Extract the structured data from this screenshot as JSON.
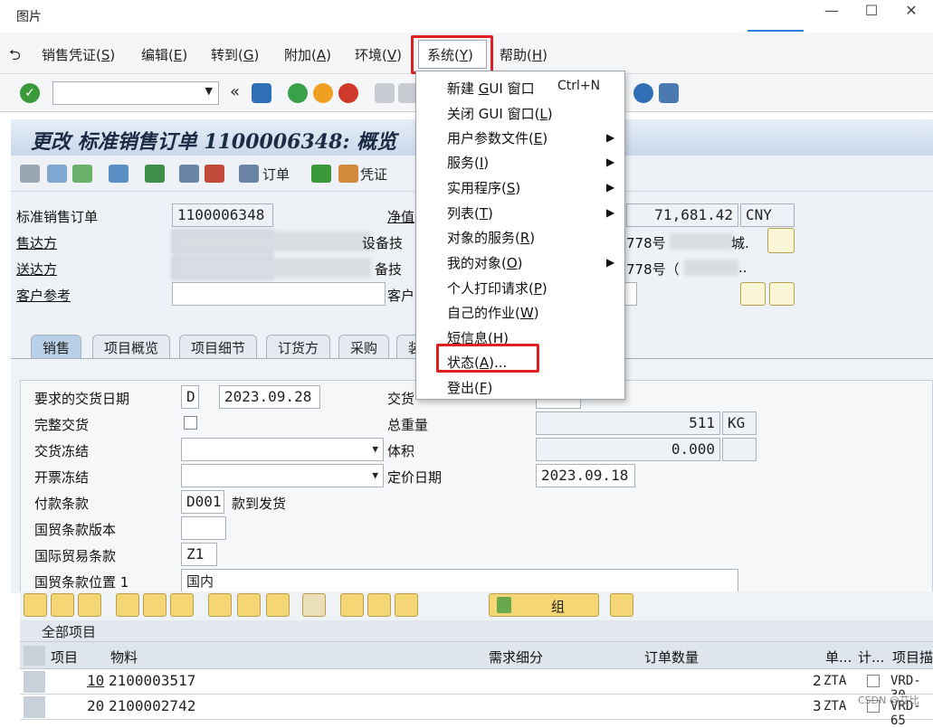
{
  "window": {
    "title": "图片",
    "controls": [
      "—",
      "☐",
      "✕"
    ]
  },
  "menubar": {
    "items": [
      {
        "label": "销售凭证(",
        "key": "S",
        "tail": ")"
      },
      {
        "label": "编辑(",
        "key": "E",
        "tail": ")"
      },
      {
        "label": "转到(",
        "key": "G",
        "tail": ")"
      },
      {
        "label": "附加(",
        "key": "A",
        "tail": ")"
      },
      {
        "label": "环境(",
        "key": "V",
        "tail": ")"
      },
      {
        "label": "系统(",
        "key": "Y",
        "tail": ")"
      },
      {
        "label": "帮助(",
        "key": "H",
        "tail": ")"
      }
    ]
  },
  "toolbar": {
    "command_value": "",
    "back_glyph": "«"
  },
  "header": {
    "title": "更改 标准销售订单 1100006348: 概览"
  },
  "app_toolbar": {
    "order_label": "订单",
    "voucher_label": "凭证"
  },
  "form": {
    "order_type_label": "标准销售订单",
    "order_number": "1100006348",
    "net_label": "净值",
    "net_value": "71,681.42",
    "currency": "CNY",
    "sold_to_label": "售达方",
    "sold_to_text": "设备技",
    "sold_to_addr": "778号",
    "sold_to_tail": "城.",
    "ship_to_label": "送达方",
    "ship_to_text": "备技",
    "ship_to_addr": "778号（",
    "ship_to_tail": "..",
    "cust_ref_label": "客户参考",
    "cust_ref_label2": "客户"
  },
  "tabs": [
    {
      "label": "销售",
      "active": true
    },
    {
      "label": "项目概览"
    },
    {
      "label": "项目细节"
    },
    {
      "label": "订货方"
    },
    {
      "label": "采购"
    },
    {
      "label": "装"
    }
  ],
  "sales_tab": {
    "req_date_label": "要求的交货日期",
    "req_date_type": "D",
    "req_date": "2023.09.28",
    "delivery_label": "交货",
    "complete_label": "完整交货",
    "gross_weight_label": "总重量",
    "gross_weight": "511",
    "weight_unit": "KG",
    "delivery_block_label": "交货冻结",
    "volume_label": "体积",
    "volume": "0.000",
    "billing_block_label": "开票冻结",
    "pricing_date_label": "定价日期",
    "pricing_date": "2023.09.18",
    "payment_terms_label": "付款条款",
    "payment_terms": "D001",
    "payment_terms_desc": "款到发货",
    "incoterms_version_label": "国贸条款版本",
    "incoterms_label": "国际贸易条款",
    "incoterms": "Z1",
    "incoterms_loc_label": "国贸条款位置 1",
    "incoterms_loc": "国内"
  },
  "item_toolbar": {
    "group_label": "组"
  },
  "items_table": {
    "title": "全部项目",
    "columns": [
      "项目",
      "物料",
      "需求细分",
      "订单数量",
      "单...",
      "计...",
      "项目描"
    ],
    "rows": [
      {
        "item": "10",
        "material": "2100003517",
        "qty": "2",
        "unit": "ZTA",
        "desc": "VRD-30"
      },
      {
        "item": "20",
        "material": "2100002742",
        "qty": "3",
        "unit": "ZTA",
        "desc": "VRD-65"
      }
    ]
  },
  "system_menu": {
    "items": [
      {
        "label": "新建 ",
        "key": "G",
        "rest": "UI 窗口",
        "shortcut": "Ctrl+N",
        "submenu": false
      },
      {
        "label": "关闭 GUI 窗口(",
        "key": "L",
        "rest": ")",
        "submenu": false
      },
      {
        "label": "用户参数文件(",
        "key": "E",
        "rest": ")",
        "submenu": true
      },
      {
        "label": "服务(",
        "key": "I",
        "rest": ")",
        "submenu": true
      },
      {
        "label": "实用程序(",
        "key": "S",
        "rest": ")",
        "submenu": true
      },
      {
        "label": "列表(",
        "key": "T",
        "rest": ")",
        "submenu": true
      },
      {
        "label": "对象的服务(",
        "key": "R",
        "rest": ")",
        "submenu": false
      },
      {
        "label": "我的对象(",
        "key": "O",
        "rest": ")",
        "submenu": true
      },
      {
        "label": "个人打印请求(",
        "key": "P",
        "rest": ")",
        "submenu": false
      },
      {
        "label": "自己的作业(",
        "key": "W",
        "rest": ")",
        "submenu": false
      },
      {
        "label": "短信息(",
        "key": "H",
        "rest": ")",
        "submenu": false
      },
      {
        "label": "状态(",
        "key": "A",
        "rest": ")...",
        "submenu": false
      },
      {
        "label": "登出(",
        "key": "F",
        "rest": ")",
        "submenu": false
      }
    ]
  },
  "watermark": "CSDN @艾比",
  "colors": {
    "highlight": "#e02020",
    "header_bg": "#c9d8ea",
    "active_tab": "#b9cfe7"
  }
}
